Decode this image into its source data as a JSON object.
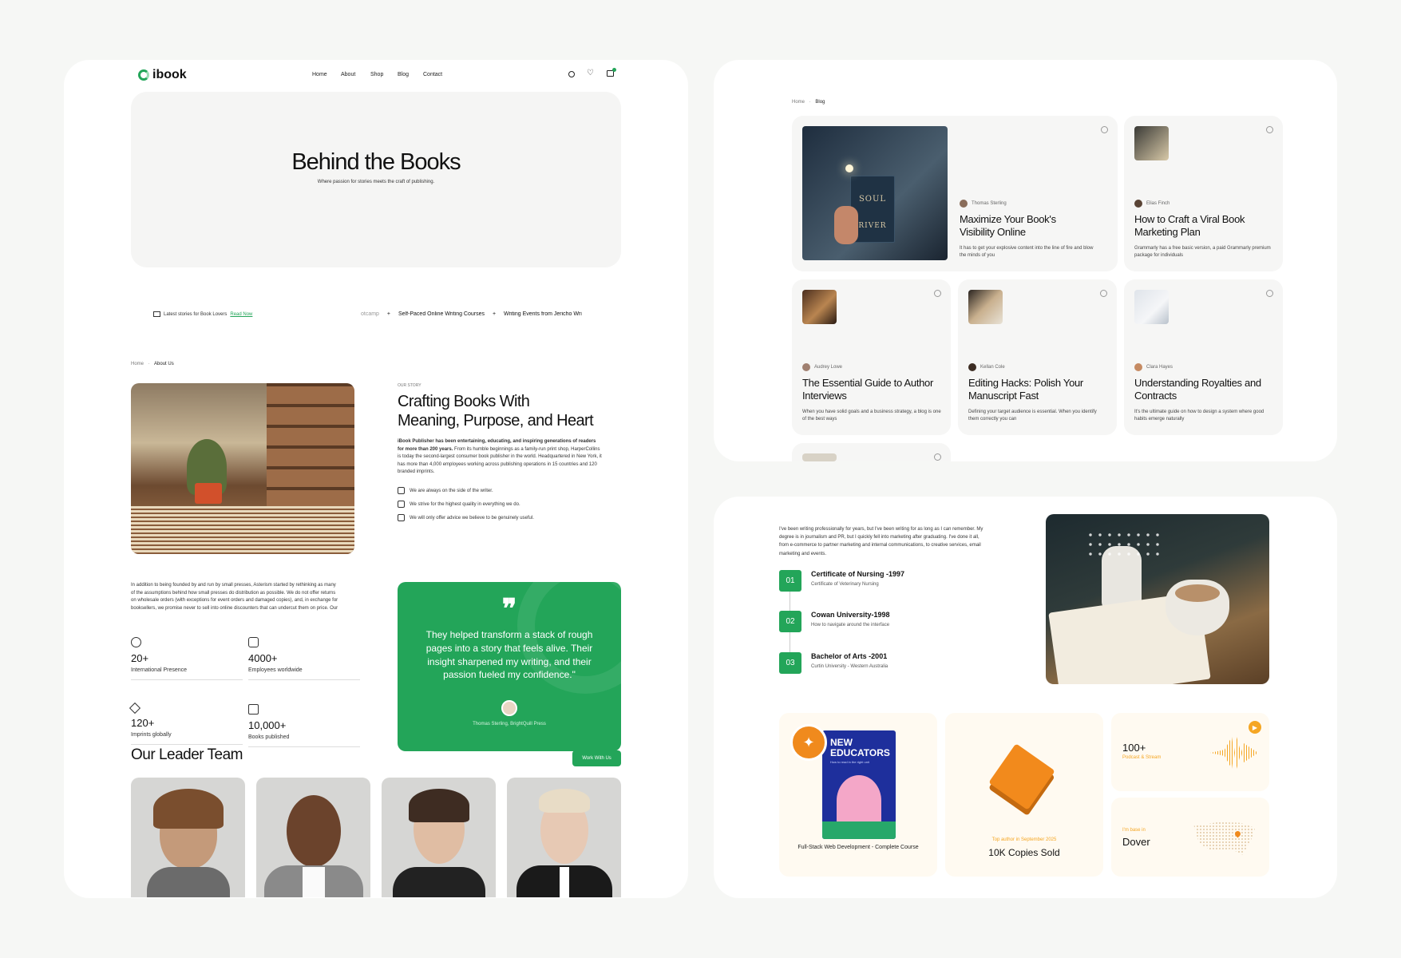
{
  "left": {
    "brand": "ibook",
    "nav": [
      "Home",
      "About",
      "Shop",
      "Blog",
      "Contact"
    ],
    "hero_title": "Behind the Books",
    "hero_subtitle": "Where passion for stories meets the craft of publishing.",
    "ticker_label": "Latest stories for Book Lovers",
    "ticker_link": "Read Now",
    "ticker_items": [
      "otcamp",
      "Self-Paced Online Writing Courses",
      "Writing Events from Jericho Wri"
    ],
    "breadcrumb": [
      "Home",
      "About Us"
    ],
    "story_eyebrow": "OUR STORY",
    "story_title_1": "Crafting Books With",
    "story_title_2": "Meaning, Purpose, and Heart",
    "story_bold": "iBook Publisher has been entertaining, educating, and inspiring generations of readers for more than 200 years.",
    "story_body": "From its humble beginnings as a family-run print shop, HarperCollins is today the second-largest consumer book publisher in the world. Headquartered in New York, it has more than 4,000 employees working across publishing operations in 15 countries and 120 branded imprints.",
    "bullets": [
      "We are always on the side of the writer.",
      "We strive for the highest quality in everything we do.",
      "We will only offer advice we believe to be genuinely useful."
    ],
    "intro_para": "In addition to being founded by and run by small presses, Asterism started by rethinking as many of the assumptions behind how small presses do distribution as possible. We do not offer returns on wholesale orders (with exceptions for event orders and damaged copies), and, in exchange for booksellers, we promise never to sell into online discounters that can undercut them on price. Our",
    "stats": [
      {
        "num": "20+",
        "label": "International Presence"
      },
      {
        "num": "4000+",
        "label": "Employees worldwide"
      },
      {
        "num": "120+",
        "label": "Imprints globally"
      },
      {
        "num": "10,000+",
        "label": "Books published"
      }
    ],
    "quote": "They helped transform a stack of rough pages into a story that feels alive. Their insight sharpened my writing, and their passion fueled my confidence.\"",
    "quote_author": "Thomas Sterling, BrightQuill Press",
    "team_title": "Our Leader Team",
    "team_button": "Work With Us"
  },
  "blog": {
    "breadcrumb": [
      "Home",
      "Blog"
    ],
    "posts": [
      {
        "author": "Thomas Sterling",
        "title": "Maximize Your Book's Visibility Online",
        "desc": "It has to get your explosive content into the line of fire and blow the minds of you"
      },
      {
        "author": "Elias Finch",
        "title": "How to Craft a Viral Book Marketing Plan",
        "desc": "Grammarly has a free basic version, a paid Grammarly premium package for individuals"
      },
      {
        "author": "Audrey Lowe",
        "title": "The Essential Guide to Author Interviews",
        "desc": "When you have solid goals and a business strategy, a blog is one of the best ways"
      },
      {
        "author": "Kellan Cole",
        "title": "Editing Hacks: Polish Your Manuscript Fast",
        "desc": "Defining your target audience is essential. When you identify them correctly you can"
      },
      {
        "author": "Clara Hayes",
        "title": "Understanding Royalties and Contracts",
        "desc": "It's the ultimate guide on how to design a system where good habits emerge naturally"
      }
    ],
    "book_cover": [
      "SOUL",
      "RIVER"
    ]
  },
  "about": {
    "para": "I've been writing professionally for years, but I've been writing for as long as I can remember. My degree is in journalism and PR, but I quickly fell into marketing after graduating. I've done it all, from e-commerce to partner marketing and internal communications, to creative services, email marketing and events.",
    "steps": [
      {
        "n": "01",
        "title": "Certificate of Nursing -1997",
        "sub": "Certificate of Veterinary Nursing"
      },
      {
        "n": "02",
        "title": "Cowan University-1998",
        "sub": "How to navigate around the interface"
      },
      {
        "n": "03",
        "title": "Bachelor of Arts -2001",
        "sub": "Curtin University - Western Australia"
      }
    ],
    "course": "Full-Stack Web Development - Complete Course",
    "cover_title_1": "NEW",
    "cover_title_2": "EDUCATORS",
    "cover_sub": "How to read in the right unit",
    "copies_top": "Top author in September 2025",
    "copies": "10K Copies Sold",
    "podcast_num": "100+",
    "podcast_lbl": "Podcast & Stream",
    "base_lbl": "I'm base in",
    "base_city": "Dover"
  },
  "colors": {
    "green": "#23a559",
    "orange": "#f5a623"
  }
}
